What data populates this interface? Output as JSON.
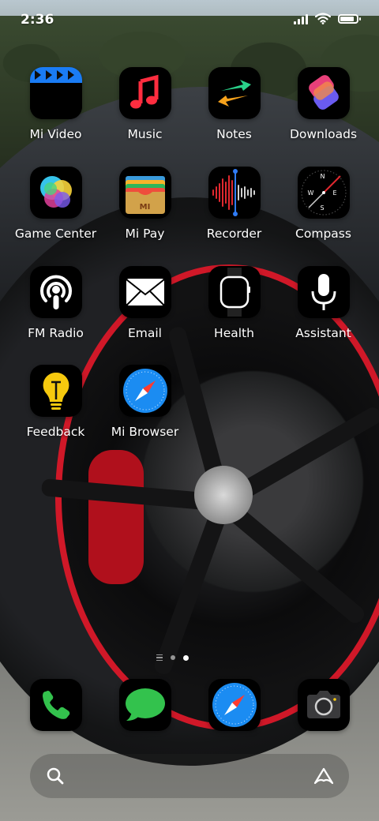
{
  "status_bar": {
    "time": "2:36",
    "signal_bars": 4,
    "wifi": "wifi-icon",
    "battery_level": 0.85
  },
  "apps": [
    {
      "label": "Mi Video",
      "icon": "video-clapper-icon"
    },
    {
      "label": "Music",
      "icon": "music-note-icon"
    },
    {
      "label": "Notes",
      "icon": "notes-arrows-icon"
    },
    {
      "label": "Downloads",
      "icon": "shortcuts-icon"
    },
    {
      "label": "Game Center",
      "icon": "game-center-icon"
    },
    {
      "label": "Mi Pay",
      "icon": "wallet-icon"
    },
    {
      "label": "Recorder",
      "icon": "waveform-icon"
    },
    {
      "label": "Compass",
      "icon": "compass-icon"
    },
    {
      "label": "FM Radio",
      "icon": "podcast-icon"
    },
    {
      "label": "Email",
      "icon": "envelope-icon"
    },
    {
      "label": "Health",
      "icon": "watch-icon"
    },
    {
      "label": "Assistant",
      "icon": "microphone-icon"
    },
    {
      "label": "Feedback",
      "icon": "lightbulb-icon"
    },
    {
      "label": "Mi Browser",
      "icon": "safari-compass-icon"
    }
  ],
  "wallet_brand": "MI",
  "compass_letters": [
    "N",
    "E",
    "S",
    "W"
  ],
  "dock": [
    {
      "name": "phone",
      "icon": "phone-icon"
    },
    {
      "name": "messages",
      "icon": "message-bubble-icon"
    },
    {
      "name": "browser",
      "icon": "safari-compass-icon"
    },
    {
      "name": "camera",
      "icon": "camera-icon"
    }
  ],
  "pager": {
    "pages": 2,
    "active": 2
  },
  "search": {
    "left_icon": "search-icon",
    "right_icon": "assistant-logo-icon"
  },
  "colors": {
    "music_red": "#ff2d3f",
    "messages_green": "#33c24d",
    "phone_green": "#33c24d",
    "safari_blue": "#1b8cf2",
    "feedback_yellow": "#f6c90e",
    "video_blue": "#1a7cf5",
    "recorder_red": "#e0282f"
  }
}
